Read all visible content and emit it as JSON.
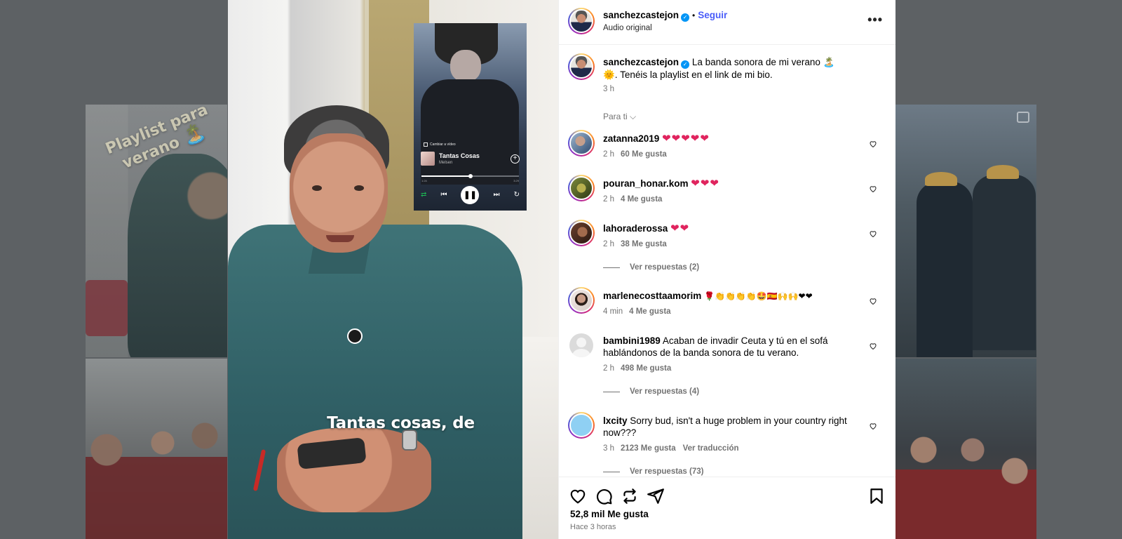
{
  "background": {
    "playlist_tag": "Playlist para verano",
    "playlist_emoji": "🏝️"
  },
  "video": {
    "subtitle": "Tantas cosas, de",
    "player": {
      "change_video": "Cambiar a vídeo",
      "track_title": "Tantas Cosas",
      "track_artist": "Melsen",
      "time_elapsed": "1:24",
      "time_total": "3:29",
      "progress": 0.5
    }
  },
  "header": {
    "username": "sanchezcastejon",
    "follow": "Seguir",
    "audio": "Audio original"
  },
  "caption": {
    "username": "sanchezcastejon",
    "text": "La banda sonora de mi verano 🏝️🌞. Tenéis la playlist en el link de mi bio.",
    "time": "3 h"
  },
  "for_you": "Para ti",
  "comments": [
    {
      "username": "zatanna2019",
      "text": "❤❤❤❤❤",
      "time": "2 h",
      "likes": "60 Me gusta"
    },
    {
      "username": "pouran_honar.kom",
      "text": "❤❤❤",
      "time": "2 h",
      "likes": "4 Me gusta"
    },
    {
      "username": "lahoraderossa",
      "text": "❤❤",
      "time": "2 h",
      "likes": "38 Me gusta",
      "replies": "Ver respuestas (2)"
    },
    {
      "username": "marlenecosttaamorim",
      "text": "🌹👏👏👏👏🤩🇪🇸🙌🙌❤❤",
      "time": "4 min",
      "likes": "4 Me gusta"
    },
    {
      "username": "bambini1989",
      "text": "Acaban de invadir Ceuta y tú en el sofá hablándonos de la banda sonora de tu verano.",
      "time": "2 h",
      "likes": "498 Me gusta",
      "replies": "Ver respuestas (4)"
    },
    {
      "username": "lxcity",
      "text": "Sorry bud, isn't a huge problem in your country right now???",
      "time": "3 h",
      "likes": "2123 Me gusta",
      "translate": "Ver traducción",
      "replies": "Ver respuestas (73)"
    }
  ],
  "footer": {
    "likes": "52,8 mil Me gusta",
    "time": "Hace 3 horas"
  }
}
